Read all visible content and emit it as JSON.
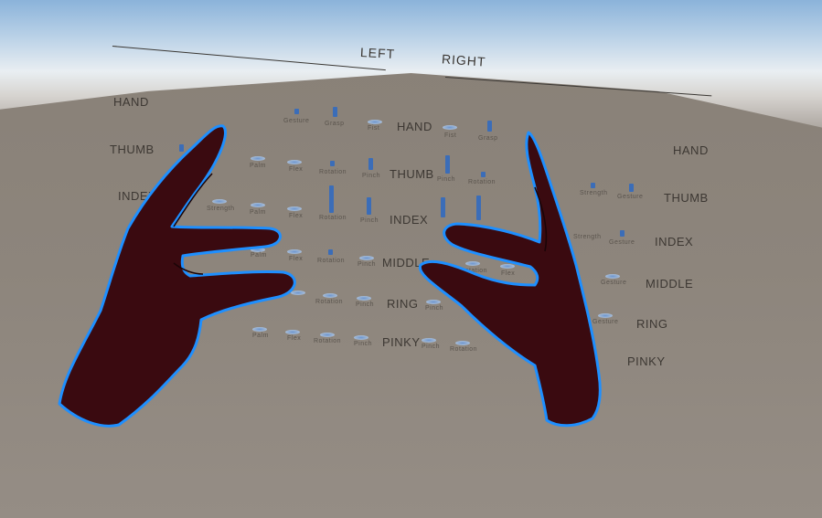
{
  "headers": {
    "left": "LEFT",
    "right": "RIGHT"
  },
  "left_rows": [
    "HAND",
    "THUMB",
    "INDEX"
  ],
  "right_rows": [
    "HAND",
    "THUMB",
    "INDEX",
    "MIDDLE",
    "RING",
    "PINKY"
  ],
  "center_rows": [
    "HAND",
    "THUMB",
    "INDEX",
    "MIDDLE",
    "RING",
    "PINKY"
  ],
  "metrics": {
    "gesture": "Gesture",
    "grasp": "Grasp",
    "fist": "Fist",
    "palm": "Palm",
    "flex": "Flex",
    "rotation": "Rotation",
    "pinch": "Pinch",
    "strength": "Strength"
  },
  "colors": {
    "hand_fill": "#3a0a10",
    "hand_outline": "#1e8fff",
    "bar": "#3b6db8"
  }
}
